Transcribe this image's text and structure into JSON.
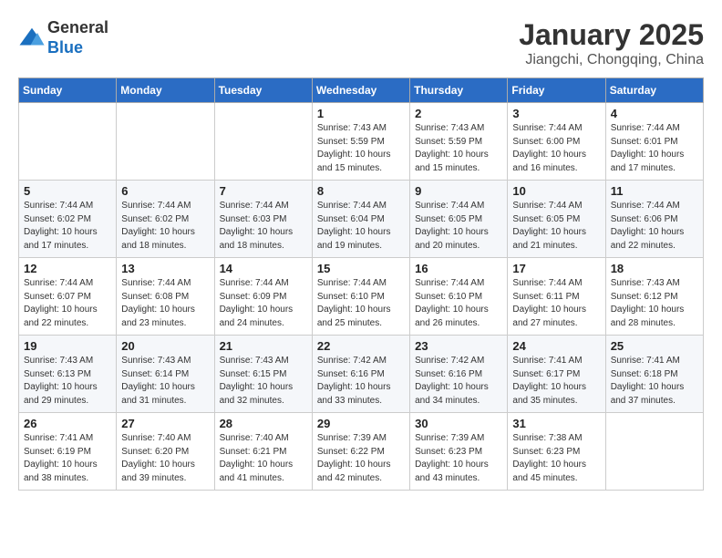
{
  "header": {
    "logo_line1": "General",
    "logo_line2": "Blue",
    "month_title": "January 2025",
    "location": "Jiangchi, Chongqing, China"
  },
  "days_of_week": [
    "Sunday",
    "Monday",
    "Tuesday",
    "Wednesday",
    "Thursday",
    "Friday",
    "Saturday"
  ],
  "weeks": [
    [
      {
        "day": "",
        "info": ""
      },
      {
        "day": "",
        "info": ""
      },
      {
        "day": "",
        "info": ""
      },
      {
        "day": "1",
        "info": "Sunrise: 7:43 AM\nSunset: 5:59 PM\nDaylight: 10 hours and 15 minutes."
      },
      {
        "day": "2",
        "info": "Sunrise: 7:43 AM\nSunset: 5:59 PM\nDaylight: 10 hours and 15 minutes."
      },
      {
        "day": "3",
        "info": "Sunrise: 7:44 AM\nSunset: 6:00 PM\nDaylight: 10 hours and 16 minutes."
      },
      {
        "day": "4",
        "info": "Sunrise: 7:44 AM\nSunset: 6:01 PM\nDaylight: 10 hours and 17 minutes."
      }
    ],
    [
      {
        "day": "5",
        "info": "Sunrise: 7:44 AM\nSunset: 6:02 PM\nDaylight: 10 hours and 17 minutes."
      },
      {
        "day": "6",
        "info": "Sunrise: 7:44 AM\nSunset: 6:02 PM\nDaylight: 10 hours and 18 minutes."
      },
      {
        "day": "7",
        "info": "Sunrise: 7:44 AM\nSunset: 6:03 PM\nDaylight: 10 hours and 18 minutes."
      },
      {
        "day": "8",
        "info": "Sunrise: 7:44 AM\nSunset: 6:04 PM\nDaylight: 10 hours and 19 minutes."
      },
      {
        "day": "9",
        "info": "Sunrise: 7:44 AM\nSunset: 6:05 PM\nDaylight: 10 hours and 20 minutes."
      },
      {
        "day": "10",
        "info": "Sunrise: 7:44 AM\nSunset: 6:05 PM\nDaylight: 10 hours and 21 minutes."
      },
      {
        "day": "11",
        "info": "Sunrise: 7:44 AM\nSunset: 6:06 PM\nDaylight: 10 hours and 22 minutes."
      }
    ],
    [
      {
        "day": "12",
        "info": "Sunrise: 7:44 AM\nSunset: 6:07 PM\nDaylight: 10 hours and 22 minutes."
      },
      {
        "day": "13",
        "info": "Sunrise: 7:44 AM\nSunset: 6:08 PM\nDaylight: 10 hours and 23 minutes."
      },
      {
        "day": "14",
        "info": "Sunrise: 7:44 AM\nSunset: 6:09 PM\nDaylight: 10 hours and 24 minutes."
      },
      {
        "day": "15",
        "info": "Sunrise: 7:44 AM\nSunset: 6:10 PM\nDaylight: 10 hours and 25 minutes."
      },
      {
        "day": "16",
        "info": "Sunrise: 7:44 AM\nSunset: 6:10 PM\nDaylight: 10 hours and 26 minutes."
      },
      {
        "day": "17",
        "info": "Sunrise: 7:44 AM\nSunset: 6:11 PM\nDaylight: 10 hours and 27 minutes."
      },
      {
        "day": "18",
        "info": "Sunrise: 7:43 AM\nSunset: 6:12 PM\nDaylight: 10 hours and 28 minutes."
      }
    ],
    [
      {
        "day": "19",
        "info": "Sunrise: 7:43 AM\nSunset: 6:13 PM\nDaylight: 10 hours and 29 minutes."
      },
      {
        "day": "20",
        "info": "Sunrise: 7:43 AM\nSunset: 6:14 PM\nDaylight: 10 hours and 31 minutes."
      },
      {
        "day": "21",
        "info": "Sunrise: 7:43 AM\nSunset: 6:15 PM\nDaylight: 10 hours and 32 minutes."
      },
      {
        "day": "22",
        "info": "Sunrise: 7:42 AM\nSunset: 6:16 PM\nDaylight: 10 hours and 33 minutes."
      },
      {
        "day": "23",
        "info": "Sunrise: 7:42 AM\nSunset: 6:16 PM\nDaylight: 10 hours and 34 minutes."
      },
      {
        "day": "24",
        "info": "Sunrise: 7:41 AM\nSunset: 6:17 PM\nDaylight: 10 hours and 35 minutes."
      },
      {
        "day": "25",
        "info": "Sunrise: 7:41 AM\nSunset: 6:18 PM\nDaylight: 10 hours and 37 minutes."
      }
    ],
    [
      {
        "day": "26",
        "info": "Sunrise: 7:41 AM\nSunset: 6:19 PM\nDaylight: 10 hours and 38 minutes."
      },
      {
        "day": "27",
        "info": "Sunrise: 7:40 AM\nSunset: 6:20 PM\nDaylight: 10 hours and 39 minutes."
      },
      {
        "day": "28",
        "info": "Sunrise: 7:40 AM\nSunset: 6:21 PM\nDaylight: 10 hours and 41 minutes."
      },
      {
        "day": "29",
        "info": "Sunrise: 7:39 AM\nSunset: 6:22 PM\nDaylight: 10 hours and 42 minutes."
      },
      {
        "day": "30",
        "info": "Sunrise: 7:39 AM\nSunset: 6:23 PM\nDaylight: 10 hours and 43 minutes."
      },
      {
        "day": "31",
        "info": "Sunrise: 7:38 AM\nSunset: 6:23 PM\nDaylight: 10 hours and 45 minutes."
      },
      {
        "day": "",
        "info": ""
      }
    ]
  ]
}
